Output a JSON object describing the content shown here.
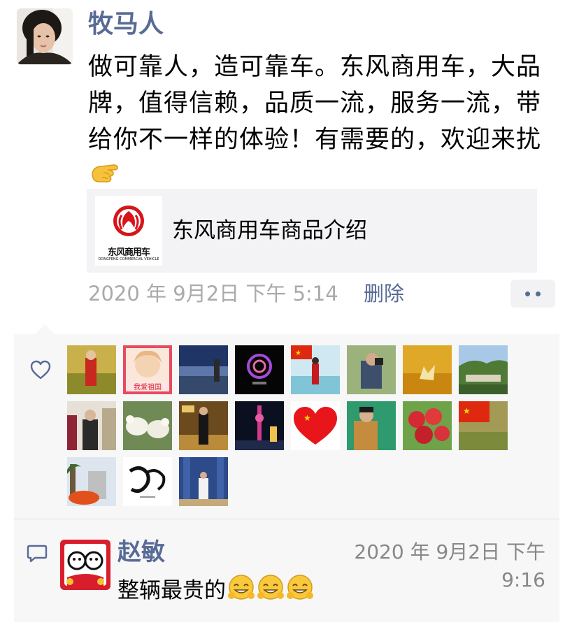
{
  "post": {
    "author": "牧马人",
    "text": "做可靠人，造可靠车。东风商用车，大品牌，值得信赖，品质一流，服务一流，带给你不一样的体验！有需要的，欢迎来扰",
    "link": {
      "title": "东风商用车商品介绍",
      "brand_cn": "东风商用车",
      "brand_en": "DONGFENG COMMERCIAL VEHICLE"
    },
    "time": "2020 年 9月2日  下午 5:14",
    "delete_label": "删除"
  },
  "likes": {
    "icon": "heart-outline-icon",
    "avatars": [
      "liker-avatar-1",
      "liker-avatar-2",
      "liker-avatar-3",
      "liker-avatar-4",
      "liker-avatar-5",
      "liker-avatar-6",
      "liker-avatar-7",
      "liker-avatar-8",
      "liker-avatar-9",
      "liker-avatar-10",
      "liker-avatar-11",
      "liker-avatar-12",
      "liker-avatar-13",
      "liker-avatar-14",
      "liker-avatar-15",
      "liker-avatar-16",
      "liker-avatar-17",
      "liker-avatar-18",
      "liker-avatar-19"
    ],
    "avatar_badge_text": "我爱祖国"
  },
  "comments": [
    {
      "name": "赵敏",
      "time": "2020 年 9月2日  下午 9:16",
      "text": "整辆最贵的"
    }
  ],
  "colors": {
    "link_blue": "#576b95",
    "meta_gray": "#aaaaaa",
    "panel_bg": "#f7f7f7",
    "brand_red": "#d7141a"
  }
}
